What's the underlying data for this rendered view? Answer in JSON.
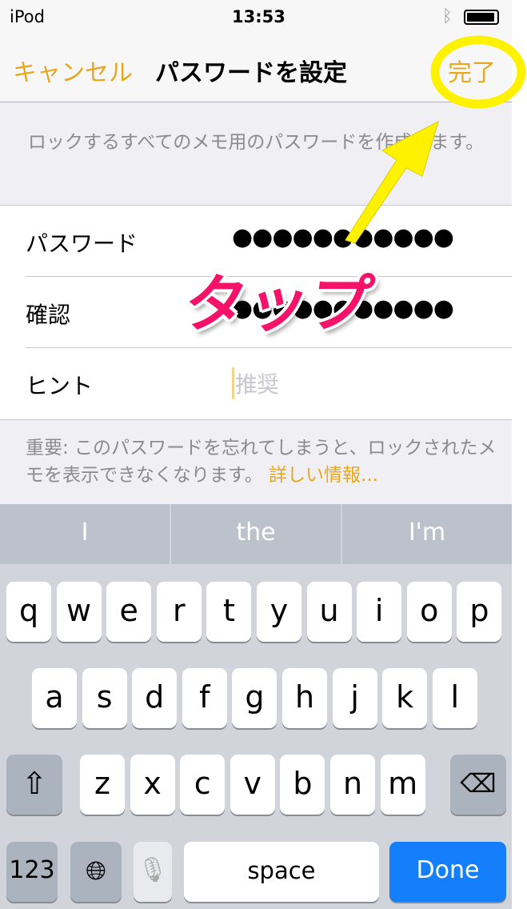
{
  "status": {
    "carrier": "iPod",
    "time": "13:53",
    "battery_level": 0.95
  },
  "nav": {
    "cancel": "キャンセル",
    "title": "パスワードを設定",
    "done": "完了"
  },
  "description": "ロックするすべてのメモ用のパスワードを作成します。",
  "form": {
    "password": {
      "label": "パスワード",
      "value": "●●●●●●●●●●●"
    },
    "confirm": {
      "label": "確認",
      "value": "●●●●●●●●●●●"
    },
    "hint": {
      "label": "ヒント",
      "placeholder": "推奨"
    }
  },
  "note": {
    "text": "重要: このパスワードを忘れてしまうと、ロックされたメモを表示できなくなります。",
    "link": "詳しい情報..."
  },
  "keyboard": {
    "suggestions": [
      "I",
      "the",
      "I'm"
    ],
    "row1": [
      "q",
      "w",
      "e",
      "r",
      "t",
      "y",
      "u",
      "i",
      "o",
      "p"
    ],
    "row2": [
      "a",
      "s",
      "d",
      "f",
      "g",
      "h",
      "j",
      "k",
      "l"
    ],
    "row3": [
      "z",
      "x",
      "c",
      "v",
      "b",
      "n",
      "m"
    ],
    "numbers": "123",
    "space": "space",
    "done": "Done"
  },
  "annotation": {
    "text": "タップ"
  },
  "colors": {
    "accent": "#e7a820",
    "done_key": "#147efb",
    "highlight": "#fff200",
    "annotation": "#f5136a"
  }
}
